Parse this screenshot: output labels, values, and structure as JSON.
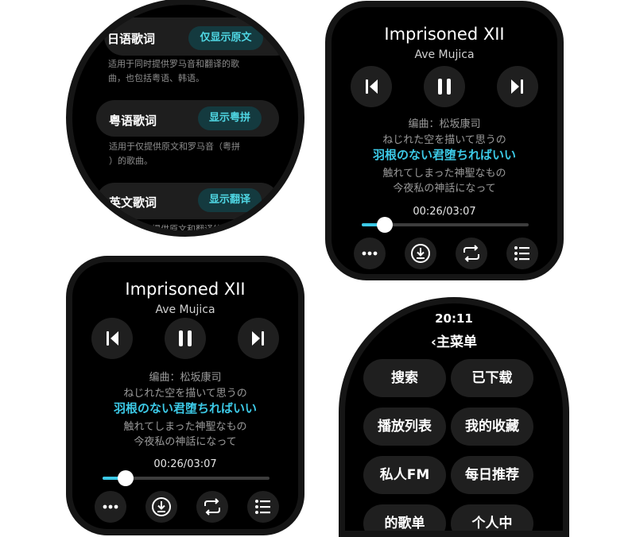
{
  "settings": {
    "sections": [
      {
        "title": "日语歌词",
        "button": "仅显示原文",
        "desc_lines": [
          "适用于同时提供罗马音和翻译的歌",
          "曲，也包括粤语、韩语。"
        ]
      },
      {
        "title": "粤语歌词",
        "button": "显示粤拼",
        "desc_lines": [
          "适用于仅提供原文和罗马音（粤拼",
          "）的歌曲。"
        ]
      },
      {
        "title": "英文歌词",
        "button": "显示翻译",
        "desc_lines": [
          "适用于仅提供原文和翻译的歌"
        ]
      }
    ]
  },
  "player": {
    "title": "Imprisoned XII",
    "artist": "Ave Mujica",
    "lyrics": [
      "编曲：松坂康司",
      "ねじれた空を描いて思うの",
      "羽根のない君堕ちればいい",
      "触れてしまった神聖なもの",
      "今夜私の神話になって"
    ],
    "highlight_index": 2,
    "time": "00:26/03:07",
    "progress": 0.139
  },
  "menu": {
    "clock": "20:11",
    "header": "‹主菜单",
    "items": [
      "搜索",
      "已下载",
      "播放列表",
      "我的收藏",
      "私人FM",
      "每日推荐",
      "的歌单",
      "个人中"
    ]
  },
  "colors": {
    "accent": "#3cc9e6",
    "button_bg": "#1f1f1f",
    "chip_bg": "#143a3f"
  },
  "icons": [
    "previous-icon",
    "pause-icon",
    "next-icon",
    "more-icon",
    "download-icon",
    "repeat-icon",
    "playlist-icon"
  ]
}
